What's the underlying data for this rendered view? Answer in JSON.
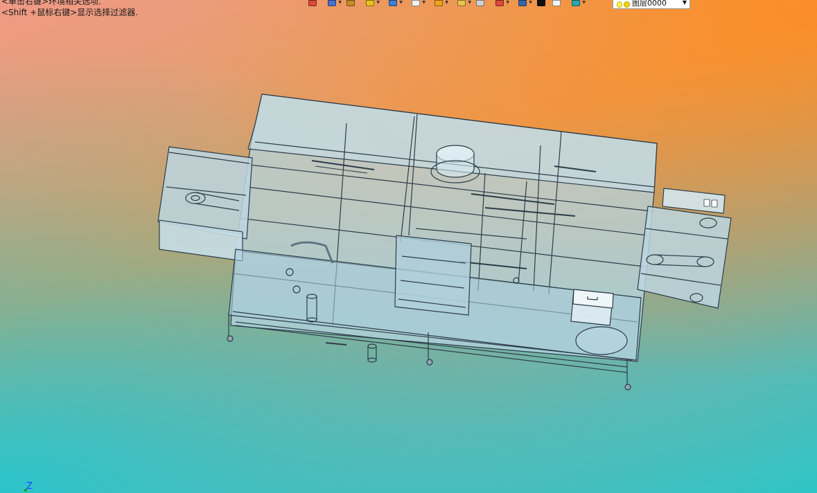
{
  "hints": {
    "line1": "<单击右键>环境相关选项.",
    "line2": "<Shift +鼠标右键>显示选择过滤器."
  },
  "toolbar": {
    "buttons": [
      {
        "icon": "view-orient-icon",
        "color": "#d94a3a",
        "dropdown": false
      },
      {
        "icon": "zoom-icon",
        "color": "#4a6fc9",
        "dropdown": true
      },
      {
        "icon": "pencil-icon",
        "color": "#c98a2a",
        "dropdown": false
      },
      {
        "icon": "shaded-box-icon",
        "color": "#e6c21a",
        "dropdown": true
      },
      {
        "icon": "blue-cube-icon",
        "color": "#3a7fd6",
        "dropdown": true
      },
      {
        "icon": "white-cube-icon",
        "color": "#f2f2f2",
        "dropdown": true
      },
      {
        "icon": "render-icon",
        "color": "#f0a21a",
        "dropdown": true
      },
      {
        "icon": "display-style-icon",
        "color": "#e8c24a",
        "dropdown": true
      },
      {
        "icon": "section-icon",
        "color": "#d0d0d0",
        "dropdown": false
      },
      {
        "icon": "hide-show-icon",
        "color": "#d94a3a",
        "dropdown": true
      },
      {
        "icon": "monitor-icon",
        "color": "#3a66a8",
        "dropdown": true
      },
      {
        "icon": "color-black-icon",
        "color": "#111111",
        "dropdown": false
      },
      {
        "icon": "color-white-icon",
        "color": "#f4f4f4",
        "dropdown": false
      },
      {
        "icon": "layers-icon",
        "color": "#2aa6b0",
        "dropdown": true
      }
    ]
  },
  "layer": {
    "label": "图层0000"
  },
  "axis": {
    "z_label": "Z"
  },
  "colors": {
    "model_fill": "#b7d7e3",
    "model_stroke": "#2c3c48",
    "background_top_right": "#ff8c1e",
    "background_bottom_left": "#1ec8d2"
  }
}
